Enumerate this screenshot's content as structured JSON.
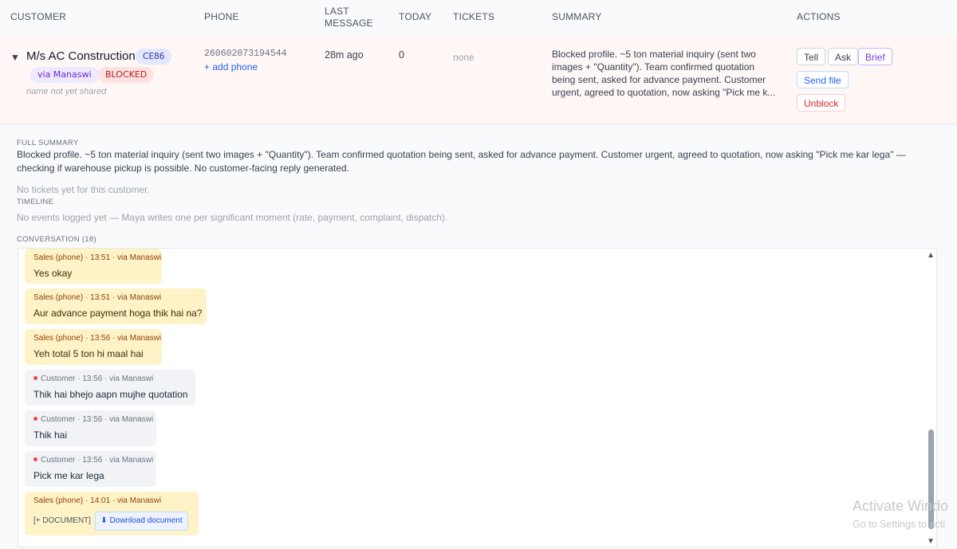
{
  "table": {
    "headers": {
      "customer": "CUSTOMER",
      "phone": "PHONE",
      "last_message_line1": "LAST",
      "last_message_line2": "MESSAGE",
      "today": "TODAY",
      "tickets": "TICKETS",
      "summary": "SUMMARY",
      "actions": "ACTIONS"
    }
  },
  "row": {
    "name": "M/s AC Construction",
    "code": "CE86",
    "via": "via Manaswi",
    "status": "BLOCKED",
    "name_note": "name not yet shared",
    "phone": "260602073194544",
    "add_phone": "+ add phone",
    "last_message": "28m ago",
    "today": "0",
    "tickets": "none",
    "summary": "Blocked profile. ~5 ton material inquiry (sent two images + \"Quantity\"). Team confirmed quotation being sent, asked for advance payment. Customer urgent, agreed to quotation, now asking \"Pick me k...",
    "actions": {
      "tell": "Tell",
      "ask": "Ask",
      "brief": "Brief",
      "send_file": "Send file",
      "unblock": "Unblock"
    }
  },
  "detail": {
    "full_summary_label": "FULL SUMMARY",
    "full_summary": "Blocked profile. ~5 ton material inquiry (sent two images + \"Quantity\"). Team confirmed quotation being sent, asked for advance payment. Customer urgent, agreed to quotation, now asking \"Pick me kar lega\" — checking if warehouse pickup is possible. No customer-facing reply generated.",
    "no_tickets": "No tickets yet for this customer.",
    "timeline_label": "TIMELINE",
    "timeline_empty": "No events logged yet — Maya writes one per significant moment (rate, payment, complaint, dispatch).",
    "conversation_label": "CONVERSATION (18)"
  },
  "messages": [
    {
      "meta": "Sales (phone) · 13:51 · via Manaswi",
      "text": "Yes okay"
    },
    {
      "meta": "Sales (phone) · 13:51 · via Manaswi",
      "text": "Aur advance payment hoga thik hai na?"
    },
    {
      "meta": "Sales (phone) · 13:56 · via Manaswi",
      "text": "Yeh total 5 ton hi maal hai"
    },
    {
      "meta": "Customer · 13:56 · via Manaswi",
      "text": "Thik hai bhejo aapn mujhe quotation"
    },
    {
      "meta": "Customer · 13:56 · via Manaswi",
      "text": "Thik hai"
    },
    {
      "meta": "Customer · 13:56 · via Manaswi",
      "text": "Pick me kar lega"
    },
    {
      "meta": "Sales (phone) · 14:01 · via Manaswi",
      "doc_label": "[+ DOCUMENT]",
      "doc_button": "⬇ Download document"
    }
  ],
  "watermark": {
    "line1": "Activate Windo",
    "line2": "Go to Settings to acti"
  }
}
